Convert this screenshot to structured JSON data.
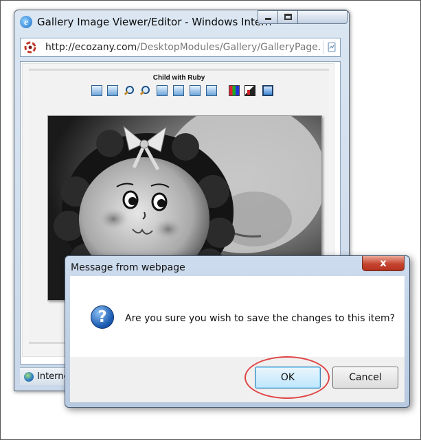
{
  "browser": {
    "title": "Gallery Image Viewer/Editor - Windows Interne",
    "address": {
      "domain": "http://ecozany.com",
      "path": "/DesktopModules/Gallery/GalleryPage.as"
    },
    "status_text": "Interne"
  },
  "gallery": {
    "image_title": "Child with Ruby",
    "toolbar_icons": [
      "add-image-icon",
      "edit-image-icon",
      "zoom-in-icon",
      "zoom-out-icon",
      "rotate-left-icon",
      "rotate-right-icon",
      "flip-horizontal-icon",
      "flip-vertical-icon",
      "color-icon",
      "grayscale-icon",
      "save-changes-icon"
    ]
  },
  "dialog": {
    "title": "Message from webpage",
    "close_label": "x",
    "icon": "question-icon",
    "message": "Are you sure you wish to save the changes to this item?",
    "ok_label": "OK",
    "cancel_label": "Cancel",
    "highlight_color": "#e04444"
  },
  "colors": {
    "window_frame": "#c9d8ea",
    "dialog_close": "#c5442f"
  }
}
